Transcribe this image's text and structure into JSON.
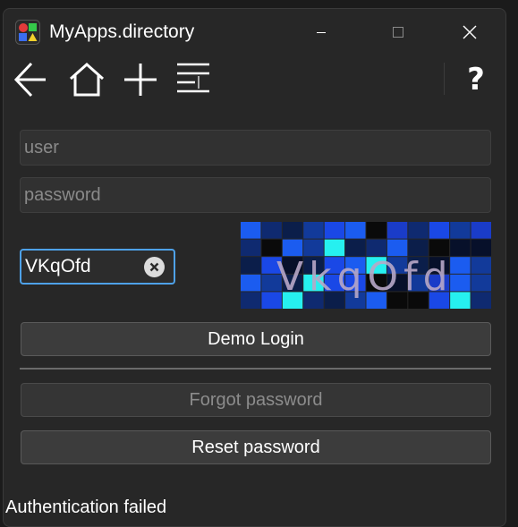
{
  "window": {
    "title": "MyApps.directory",
    "accent_color": "#4ea1e8",
    "background": "#272727"
  },
  "toolbar": {
    "items": [
      {
        "icon": "back-arrow-icon"
      },
      {
        "icon": "home-icon"
      },
      {
        "icon": "plus-icon"
      },
      {
        "icon": "menu-lines-icon"
      }
    ],
    "help_label": "?"
  },
  "login": {
    "user_placeholder": "user",
    "user_value": "",
    "password_placeholder": "password",
    "password_value": "",
    "captcha_value": "VKqOfd",
    "captcha_image_text": "VkqOfd"
  },
  "buttons": {
    "demo_login": "Demo Login",
    "forgot_password": "Forgot password",
    "reset_password": "Reset password"
  },
  "status": {
    "message": "Authentication failed"
  }
}
